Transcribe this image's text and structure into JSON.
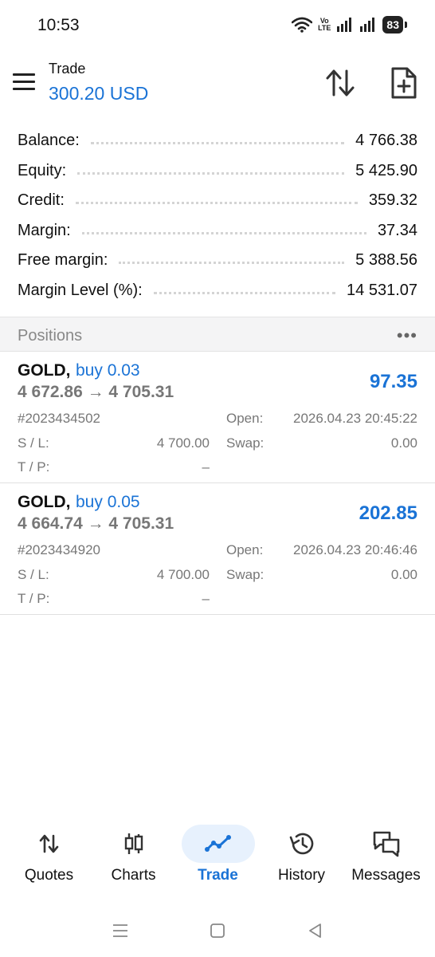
{
  "status_bar": {
    "time": "10:53",
    "battery": "83",
    "volte_top": "Vo",
    "volte_bottom": "LTE"
  },
  "header": {
    "label": "Trade",
    "balance": "300.20 USD",
    "icons": [
      "menu-icon",
      "sort-icon",
      "new-order-icon"
    ]
  },
  "summary": [
    {
      "label": "Balance:",
      "value": "4 766.38"
    },
    {
      "label": "Equity:",
      "value": "5 425.90"
    },
    {
      "label": "Credit:",
      "value": "359.32"
    },
    {
      "label": "Margin:",
      "value": "37.34"
    },
    {
      "label": "Free margin:",
      "value": "5 388.56"
    },
    {
      "label": "Margin Level (%):",
      "value": "14 531.07"
    }
  ],
  "positions_section": {
    "title": "Positions",
    "more": "•••"
  },
  "positions": [
    {
      "symbol": "GOLD,",
      "side": "buy 0.03",
      "prices": "4 672.86 → 4 705.31",
      "profit": "97.35",
      "ticket": "#2023434502",
      "open_label": "Open:",
      "open_value": "2026.04.23 20:45:22",
      "sl_label": "S / L:",
      "sl_value": "4 700.00",
      "swap_label": "Swap:",
      "swap_value": "0.00",
      "tp_label": "T / P:",
      "tp_value": "–"
    },
    {
      "symbol": "GOLD,",
      "side": "buy 0.05",
      "prices": "4 664.74 → 4 705.31",
      "profit": "202.85",
      "ticket": "#2023434920",
      "open_label": "Open:",
      "open_value": "2026.04.23 20:46:46",
      "sl_label": "S / L:",
      "sl_value": "4 700.00",
      "swap_label": "Swap:",
      "swap_value": "0.00",
      "tp_label": "T / P:",
      "tp_value": "–"
    }
  ],
  "bottom_nav": [
    {
      "label": "Quotes",
      "icon": "quotes-icon",
      "active": false
    },
    {
      "label": "Charts",
      "icon": "charts-icon",
      "active": false
    },
    {
      "label": "Trade",
      "icon": "trade-icon",
      "active": true
    },
    {
      "label": "History",
      "icon": "history-icon",
      "active": false
    },
    {
      "label": "Messages",
      "icon": "messages-icon",
      "active": false
    }
  ],
  "colors": {
    "accent": "#1a73d6",
    "muted_text": "#777777",
    "active_nav_bg": "#e7f1fd",
    "section_bg": "#f4f4f5"
  }
}
